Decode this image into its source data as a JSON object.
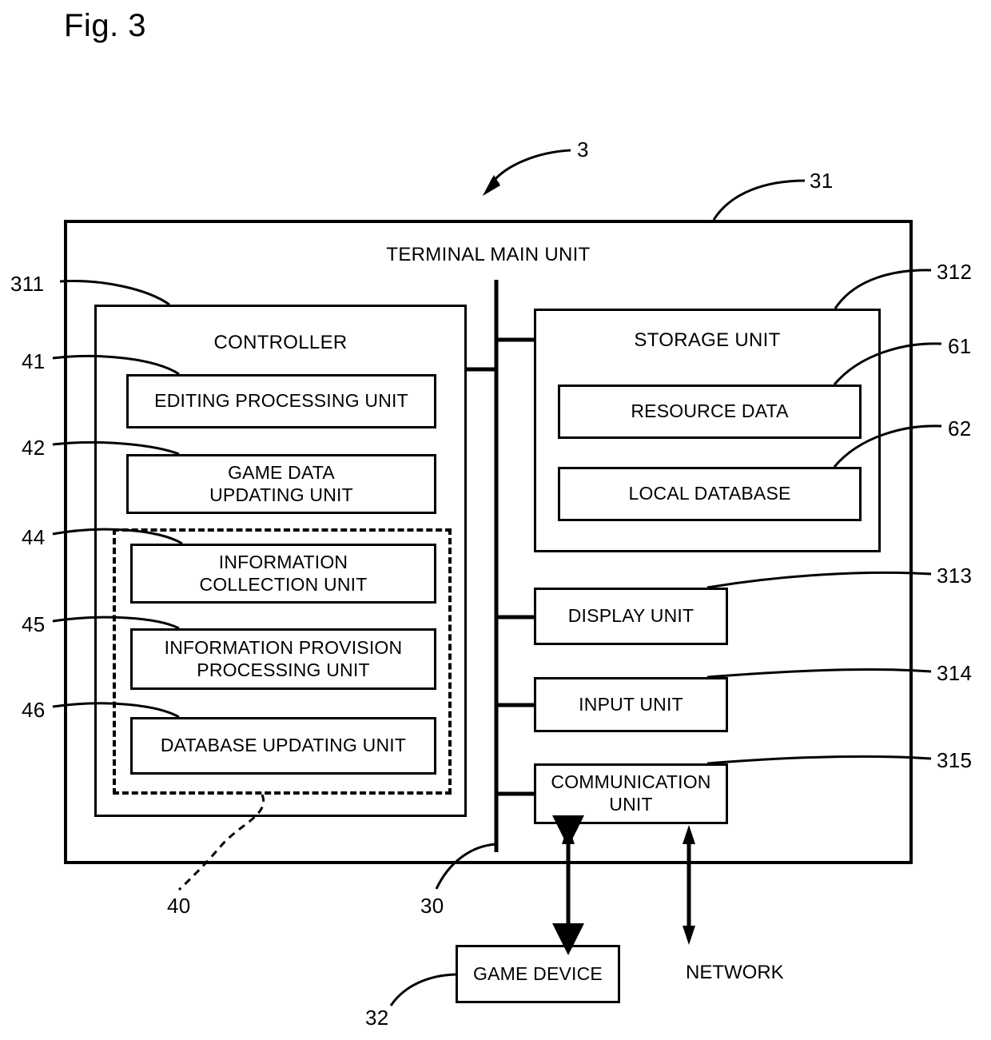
{
  "figure": {
    "label": "Fig. 3",
    "top_ref": "3"
  },
  "outer": {
    "title": "TERMINAL MAIN UNIT",
    "ref": "31"
  },
  "bus": {
    "ref": "30"
  },
  "controller": {
    "title": "CONTROLLER",
    "ref": "311",
    "units": [
      {
        "label": "EDITING PROCESSING UNIT",
        "ref": "41"
      },
      {
        "label": "GAME DATA\nUPDATING UNIT",
        "ref": "42"
      },
      {
        "label": "INFORMATION\nCOLLECTION UNIT",
        "ref": "44"
      },
      {
        "label": "INFORMATION PROVISION\nPROCESSING UNIT",
        "ref": "45"
      },
      {
        "label": "DATABASE UPDATING UNIT",
        "ref": "46"
      }
    ],
    "dashed_group_ref": "40"
  },
  "storage": {
    "title": "STORAGE UNIT",
    "ref": "312",
    "units": [
      {
        "label": "RESOURCE DATA",
        "ref": "61"
      },
      {
        "label": "LOCAL DATABASE",
        "ref": "62"
      }
    ]
  },
  "peripherals": [
    {
      "label": "DISPLAY UNIT",
      "ref": "313"
    },
    {
      "label": "INPUT UNIT",
      "ref": "314"
    },
    {
      "label": "COMMUNICATION\nUNIT",
      "ref": "315"
    }
  ],
  "external": {
    "game_device": {
      "label": "GAME DEVICE",
      "ref": "32"
    },
    "network": {
      "label": "NETWORK"
    }
  }
}
